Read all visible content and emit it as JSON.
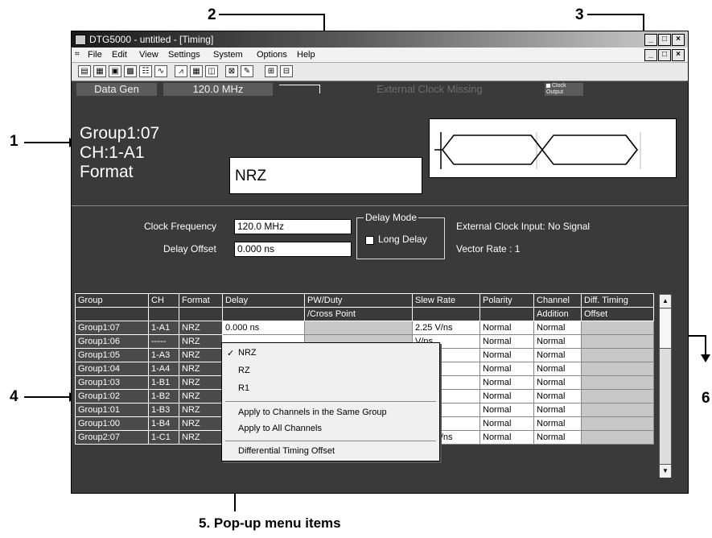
{
  "callouts": [
    "1",
    "2",
    "3",
    "4",
    "5. Pop-up menu items",
    "6"
  ],
  "window": {
    "title": "DTG5000 - untitled - [Timing]",
    "controls": [
      "_",
      "□",
      "×"
    ]
  },
  "menu": [
    "File",
    "Edit",
    "View",
    "Settings",
    "System",
    "Options",
    "Help"
  ],
  "status": {
    "mode": "Data Gen",
    "clock": "120.0 MHz",
    "external": "External Clock Missing",
    "clock_output": "Clock Output"
  },
  "info": {
    "line1": "Group1:07",
    "line2": "CH:1-A1",
    "line3": "Format",
    "value": "NRZ"
  },
  "settings": {
    "clock_label": "Clock Frequency",
    "clock_value": "120.0 MHz",
    "delay_label": "Delay Offset",
    "delay_value": "0.000 ns",
    "delay_mode_title": "Delay Mode",
    "long_delay": "Long Delay",
    "ext_input": "External Clock Input: No Signal",
    "vector_rate": "Vector Rate : 1"
  },
  "table": {
    "headers": [
      "Group",
      "CH",
      "Format",
      "Delay",
      "PW/Duty",
      "Slew Rate",
      "Polarity",
      "Channel",
      "Diff. Timing"
    ],
    "subheaders": [
      "",
      "",
      "",
      "",
      "/Cross Point",
      "",
      "",
      "Addition",
      "Offset"
    ],
    "rows": [
      {
        "group": "Group1:07",
        "ch": "1-A1",
        "format": "NRZ",
        "delay": "0.000 ns",
        "slew": "2.25 V/ns",
        "polarity": "Normal",
        "channel": "Normal"
      },
      {
        "group": "Group1:06",
        "ch": "-----",
        "format": "NRZ",
        "delay": "",
        "slew": "V/ns",
        "polarity": "Normal",
        "channel": "Normal"
      },
      {
        "group": "Group1:05",
        "ch": "1-A3",
        "format": "NRZ",
        "delay": "",
        "slew": "V/ns",
        "polarity": "Normal",
        "channel": "Normal"
      },
      {
        "group": "Group1:04",
        "ch": "1-A4",
        "format": "NRZ",
        "delay": "",
        "slew": "V/ns",
        "polarity": "Normal",
        "channel": "Normal"
      },
      {
        "group": "Group1:03",
        "ch": "1-B1",
        "format": "NRZ",
        "delay": "",
        "slew": "V/ns",
        "polarity": "Normal",
        "channel": "Normal"
      },
      {
        "group": "Group1:02",
        "ch": "1-B2",
        "format": "NRZ",
        "delay": "",
        "slew": "V/ns",
        "polarity": "Normal",
        "channel": "Normal"
      },
      {
        "group": "Group1:01",
        "ch": "1-B3",
        "format": "NRZ",
        "delay": "",
        "slew": "V/ns",
        "polarity": "Normal",
        "channel": "Normal"
      },
      {
        "group": "Group1:00",
        "ch": "1-B4",
        "format": "NRZ",
        "delay": "",
        "slew": "V/ns",
        "polarity": "Normal",
        "channel": "Normal"
      },
      {
        "group": "Group2:07",
        "ch": "1-C1",
        "format": "NRZ",
        "delay": "0.000 ns",
        "slew": "2.25 V/ns",
        "polarity": "Normal",
        "channel": "Normal"
      }
    ]
  },
  "popup": {
    "items": [
      "NRZ",
      "RZ",
      "R1"
    ],
    "checked": "✓",
    "apply_same": "Apply to Channels in the Same Group",
    "apply_all": "Apply to All Channels",
    "diff": "Differential Timing Offset"
  }
}
